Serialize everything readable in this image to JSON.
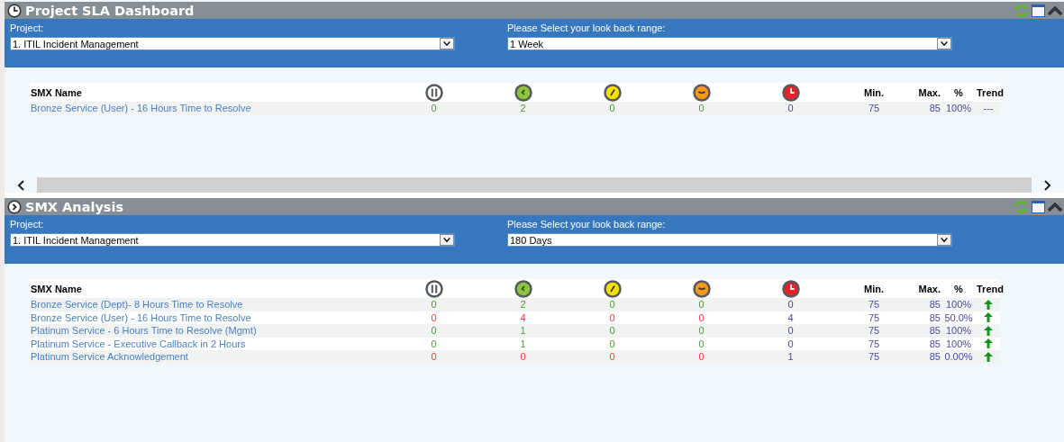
{
  "panels": [
    {
      "title": "Project SLA Dashboard",
      "project_label": "Project:",
      "project": "1. ITIL Incident Management",
      "range_label": "Please Select your look back range:",
      "range": "1 Week",
      "columns": [
        "SMX Name",
        "Min.",
        "Max.",
        "%",
        "Trend"
      ],
      "rows": [
        {
          "name": "Bronze Service (User) - 16 Hours Time to Resolve",
          "alert": false,
          "counts": [
            "0",
            "2",
            "0",
            "0",
            "0"
          ],
          "min": "75",
          "max": "85",
          "pct": "100%",
          "trend": {
            "kind": "text",
            "text": "---"
          }
        }
      ]
    },
    {
      "title": "SMX Analysis",
      "project_label": "Project:",
      "project": "1. ITIL Incident Management",
      "range_label": "Please Select your look back range:",
      "range": "180 Days",
      "columns": [
        "SMX Name",
        "Min.",
        "Max.",
        "%",
        "Trend"
      ],
      "rows": [
        {
          "name": "Bronze Service (Dept)- 8 Hours Time to Resolve",
          "alert": false,
          "counts": [
            "0",
            "2",
            "0",
            "0",
            "0"
          ],
          "min": "75",
          "max": "85",
          "pct": "100%",
          "trend": {
            "kind": "up"
          }
        },
        {
          "name": "Bronze Service (User) - 16 Hours Time to Resolve",
          "alert": true,
          "counts": [
            "0",
            "4",
            "0",
            "0",
            "4"
          ],
          "min": "75",
          "max": "85",
          "pct": "50.0%",
          "trend": {
            "kind": "up"
          }
        },
        {
          "name": "Platinum Service - 6 Hours Time to Resolve (Mgmt)",
          "alert": false,
          "counts": [
            "0",
            "1",
            "0",
            "0",
            "0"
          ],
          "min": "75",
          "max": "85",
          "pct": "100%",
          "trend": {
            "kind": "up"
          }
        },
        {
          "name": "Platinum Service - Executive Callback in 2 Hours",
          "alert": false,
          "counts": [
            "0",
            "1",
            "0",
            "0",
            "0"
          ],
          "min": "75",
          "max": "85",
          "pct": "100%",
          "trend": {
            "kind": "up"
          }
        },
        {
          "name": "Platinum Service Acknowledgement",
          "alert": true,
          "counts": [
            "0",
            "0",
            "0",
            "0",
            "1"
          ],
          "min": "75",
          "max": "85",
          "pct": "0.00%",
          "trend": {
            "kind": "up"
          }
        }
      ]
    }
  ]
}
